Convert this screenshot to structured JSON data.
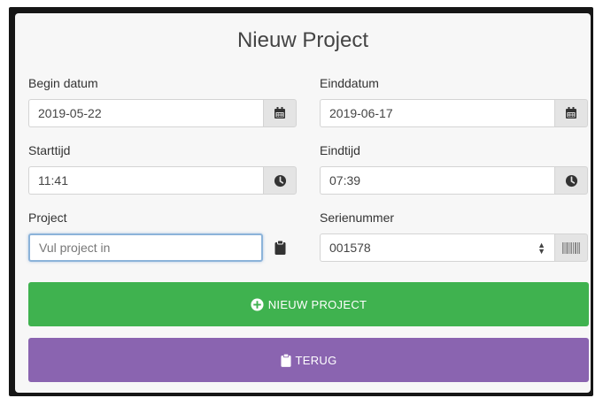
{
  "form": {
    "title": "Nieuw Project",
    "begin_label": "Begin datum",
    "begin_value": "2019-05-22",
    "end_label": "Einddatum",
    "end_value": "2019-06-17",
    "start_time_label": "Starttijd",
    "start_time_value": "11:41",
    "end_time_label": "Eindtijd",
    "end_time_value": "07:39",
    "project_label": "Project",
    "project_placeholder": "Vul project in",
    "serial_label": "Serienummer",
    "serial_value": "001578"
  },
  "buttons": {
    "new_project": "NIEUW PROJECT",
    "back": "TERUG"
  },
  "icons": {
    "calendar": "calendar-icon",
    "clock": "clock-icon",
    "clipboard": "clipboard-icon",
    "barcode": "barcode-icon",
    "plus_circle": "plus-circle-icon"
  },
  "colors": {
    "green": "#3fb24f",
    "purple": "#8a64b0"
  }
}
